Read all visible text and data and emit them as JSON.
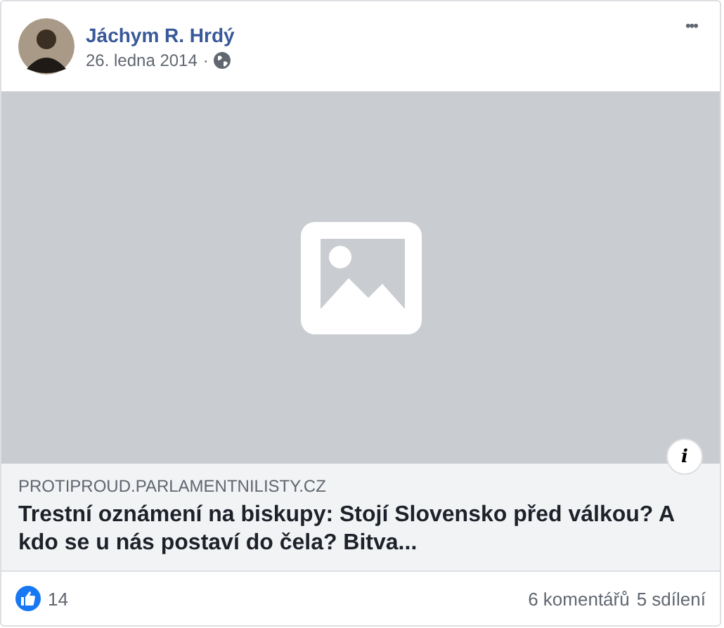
{
  "post": {
    "author": "Jáchym R. Hrdý",
    "date": "26. ledna 2014",
    "separator": "·",
    "more": "•••"
  },
  "link": {
    "domain": "PROTIPROUD.PARLAMENTNILISTY.CZ",
    "title": "Trestní oznámení na biskupy: Stojí Slovensko před válkou? A kdo se u nás postaví do čela? Bitva...",
    "info": "i"
  },
  "footer": {
    "likes": "14",
    "comments": "6 komentářů",
    "shares": "5 sdílení"
  }
}
